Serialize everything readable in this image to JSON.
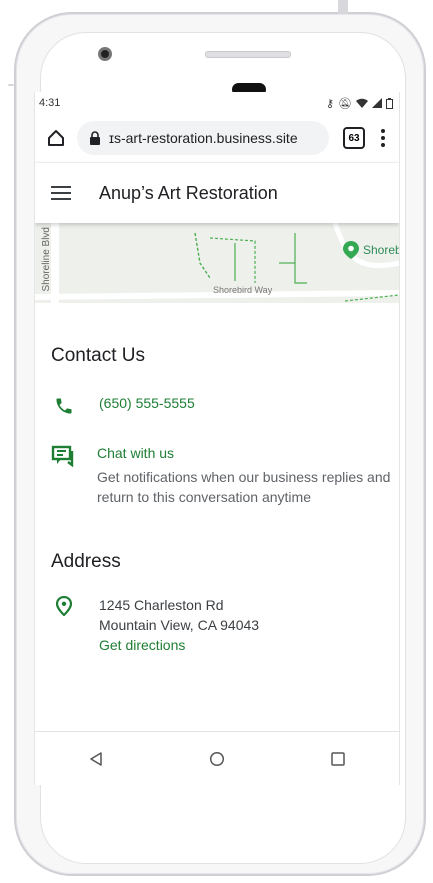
{
  "status": {
    "time": "4:31"
  },
  "browser": {
    "url": "ɪs-art-restoration.business.site",
    "tab_count": "63"
  },
  "app": {
    "title": "Anup’s Art Restoration"
  },
  "map": {
    "street_vertical": "Shoreline Blvd",
    "street_horizontal": "Shorebird Way",
    "poi": "Shorebird"
  },
  "contact": {
    "title": "Contact Us",
    "phone": "(650) 555-5555",
    "chat_label": "Chat with us",
    "chat_desc": "Get notifications when our business replies and return to this conversation anytime"
  },
  "address": {
    "title": "Address",
    "line1": "1245 Charleston Rd",
    "line2": "Mountain View, CA 94043",
    "directions": "Get directions"
  },
  "colors": {
    "accent_green": "#1e7e34"
  }
}
